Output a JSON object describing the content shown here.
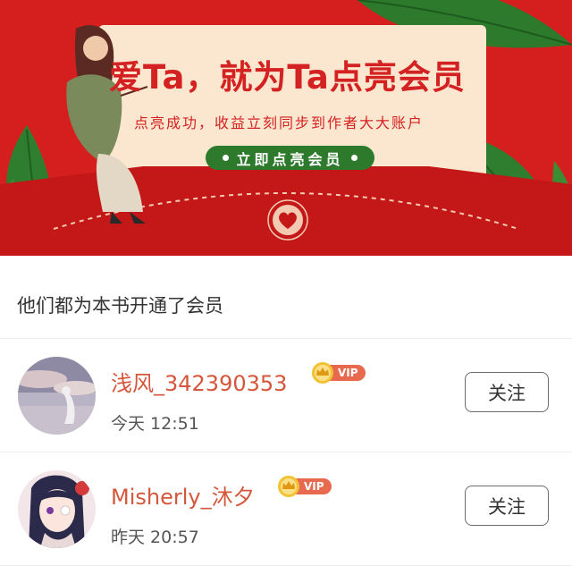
{
  "banner": {
    "headline": "爱Ta，就为Ta点亮会员",
    "subline": "点亮成功，收益立刻同步到作者大大账户",
    "cta_label": "立即点亮会员"
  },
  "section": {
    "title": "他们都为本书开通了会员"
  },
  "members": [
    {
      "name": "浅风_342390353",
      "badge": "VIP",
      "time": "今天 12:51",
      "follow_label": "关注"
    },
    {
      "name": "Misherly_沐夕",
      "badge": "VIP",
      "time": "昨天 20:57",
      "follow_label": "关注"
    }
  ],
  "colors": {
    "banner_red": "#d51f1f",
    "cta_green": "#2d7a2d",
    "name_color": "#d4573c",
    "vip_pill": "#e76a4f"
  }
}
